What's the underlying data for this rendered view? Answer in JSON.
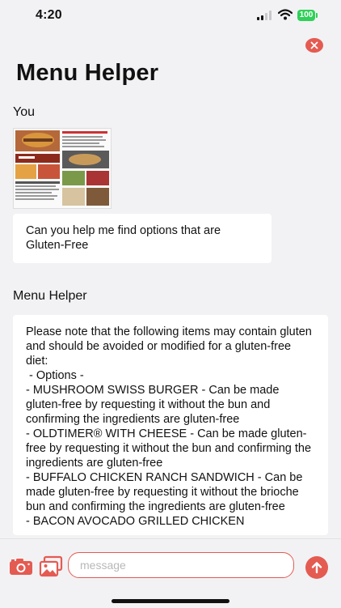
{
  "status_bar": {
    "time": "4:20",
    "battery": "100"
  },
  "header": {
    "title": "Menu Helper"
  },
  "conversation": {
    "user_name": "You",
    "user_message": "Can you help me find options that are Gluten-Free",
    "assistant_name": "Menu Helper",
    "assistant_lines": [
      "Please note that the following items may contain gluten and should be avoided or modified for a gluten-free diet:",
      " - Options -",
      "- MUSHROOM SWISS BURGER - Can be made gluten-free by requesting it without the bun and confirming the ingredients are gluten-free",
      "- OLDTIMER® WITH CHEESE - Can be made gluten-free by requesting it without the bun and confirming the ingredients are gluten-free",
      "- BUFFALO CHICKEN RANCH SANDWICH - Can be made gluten-free by requesting it without the brioche bun and confirming the ingredients are gluten-free",
      "- BACON AVOCADO GRILLED CHICKEN"
    ]
  },
  "composer": {
    "placeholder": "message"
  },
  "colors": {
    "accent": "#e45b52",
    "background": "#f2f2f4",
    "bubble": "#ffffff"
  }
}
